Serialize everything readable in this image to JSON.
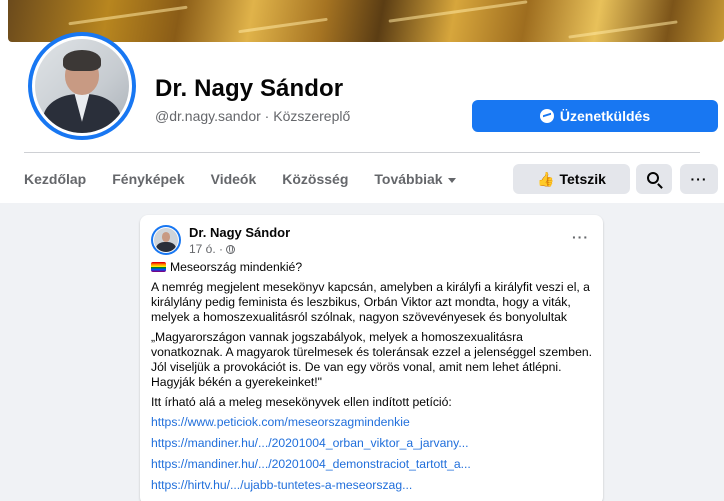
{
  "page": {
    "name": "Dr. Nagy Sándor",
    "handle": "@dr.nagy.sandor · Közszereplő"
  },
  "actions": {
    "message_label": "Üzenetküldés",
    "like_label": "Tetszik",
    "more_label": "···"
  },
  "tabs": [
    {
      "label": "Kezdőlap"
    },
    {
      "label": "Fényképek"
    },
    {
      "label": "Videók"
    },
    {
      "label": "Közösség"
    },
    {
      "label": "Továbbiak"
    }
  ],
  "post": {
    "author": "Dr. Nagy Sándor",
    "time": "17 ó. ·",
    "menu": "···",
    "title": "Meseország mindenkié?",
    "paragraph1": "A nemrég megjelent mesekönyv kapcsán, amelyben a királyfi a királyfit veszi el, a királylány pedig feminista és leszbikus, Orbán Viktor azt mondta, hogy a viták, melyek a homoszexualitásról szólnak, nagyon szövevényesek és bonyolultak",
    "quote": "„Magyarországon vannak jogszabályok, melyek a homoszexualitásra vonatkoznak. A magyarok türelmesek és toleránsak ezzel a jelenséggel szemben. Jól viseljük a provokációt is. De van egy vörös vonal, amit nem lehet átlépni. Hagyják békén a gyerekeinket!\"",
    "petition_text": "Itt írható alá a meleg mesekönyvek ellen indított petíció:",
    "links": [
      "https://www.peticiok.com/meseorszagmindenkie",
      "https://mandiner.hu/.../20201004_orban_viktor_a_jarvany...",
      "https://mandiner.hu/.../20201004_demonstraciot_tartott_a...",
      "https://hirtv.hu/.../ujabb-tuntetes-a-meseorszag..."
    ]
  }
}
